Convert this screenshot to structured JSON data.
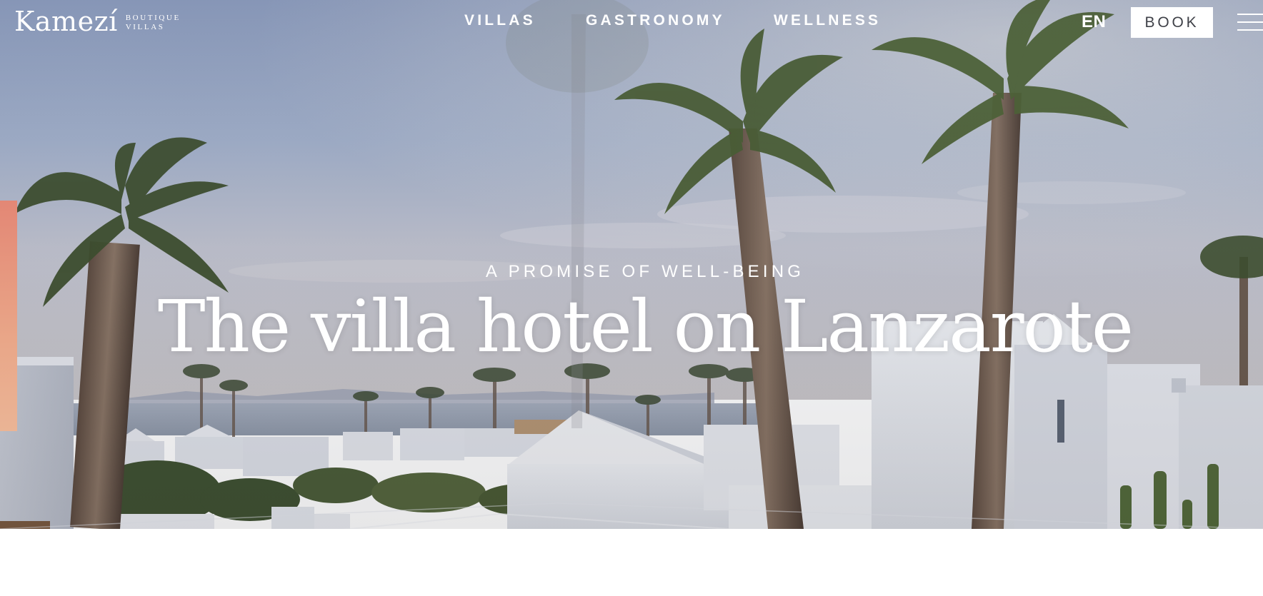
{
  "brand": {
    "name": "Kamezí",
    "tagline_line1": "BOUTIQUE",
    "tagline_line2": "VILLAS"
  },
  "nav": {
    "items": [
      {
        "label": "VILLAS"
      },
      {
        "label": "GASTRONOMY"
      },
      {
        "label": "WELLNESS"
      }
    ]
  },
  "header": {
    "language": "EN",
    "book_label": "BOOK"
  },
  "hero": {
    "eyebrow": "A PROMISE OF WELL-BEING",
    "headline": "The villa hotel on Lanzarote"
  },
  "colors": {
    "accent_tab": "#e38775",
    "book_text": "#3f4148",
    "header_text": "#ffffff"
  },
  "icons": {
    "menu": "hamburger-menu-icon"
  }
}
